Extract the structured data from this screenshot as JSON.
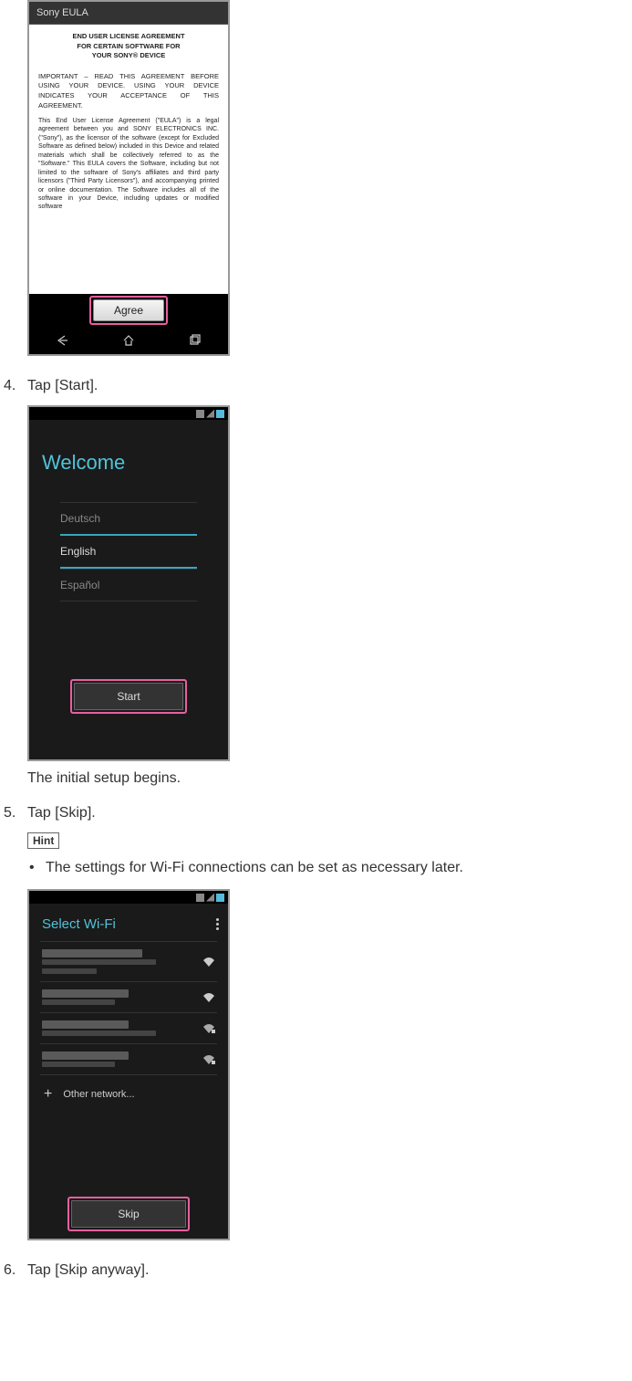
{
  "steps": {
    "s4": {
      "num": "4.",
      "text": "Tap [Start].",
      "caption": "The initial setup begins."
    },
    "s5": {
      "num": "5.",
      "text": "Tap [Skip].",
      "hint_label": "Hint",
      "bullet": "The settings for Wi-Fi connections can be set as necessary later."
    },
    "s6": {
      "num": "6.",
      "text": "Tap [Skip anyway]."
    }
  },
  "eula": {
    "header": "Sony EULA",
    "title_line1": "END USER LICENSE AGREEMENT",
    "title_line2": "FOR CERTAIN SOFTWARE FOR",
    "title_line3": "YOUR SONY® DEVICE",
    "important": "IMPORTANT – READ THIS AGREEMENT BEFORE USING YOUR DEVICE. USING YOUR DEVICE INDICATES YOUR ACCEPTANCE OF THIS AGREEMENT.",
    "para": "This End User License Agreement (\"EULA\") is a legal agreement between you and SONY ELECTRONICS INC. (\"Sony\"), as the licensor of the software (except for Excluded Software as defined below) included in this Device and related materials which shall be collectively referred to as the \"Software.\" This EULA covers the Software, including but not limited to the software of Sony's affiliates and third party licensors (\"Third Party Licensors\"), and accompanying printed or online documentation. The Software includes all of the software in your Device, including updates or modified software",
    "agree": "Agree"
  },
  "welcome": {
    "title": "Welcome",
    "lang1": "Deutsch",
    "lang2": "English",
    "lang3": "Español",
    "start": "Start"
  },
  "wifi": {
    "title": "Select Wi-Fi",
    "other": "Other network...",
    "skip": "Skip"
  }
}
